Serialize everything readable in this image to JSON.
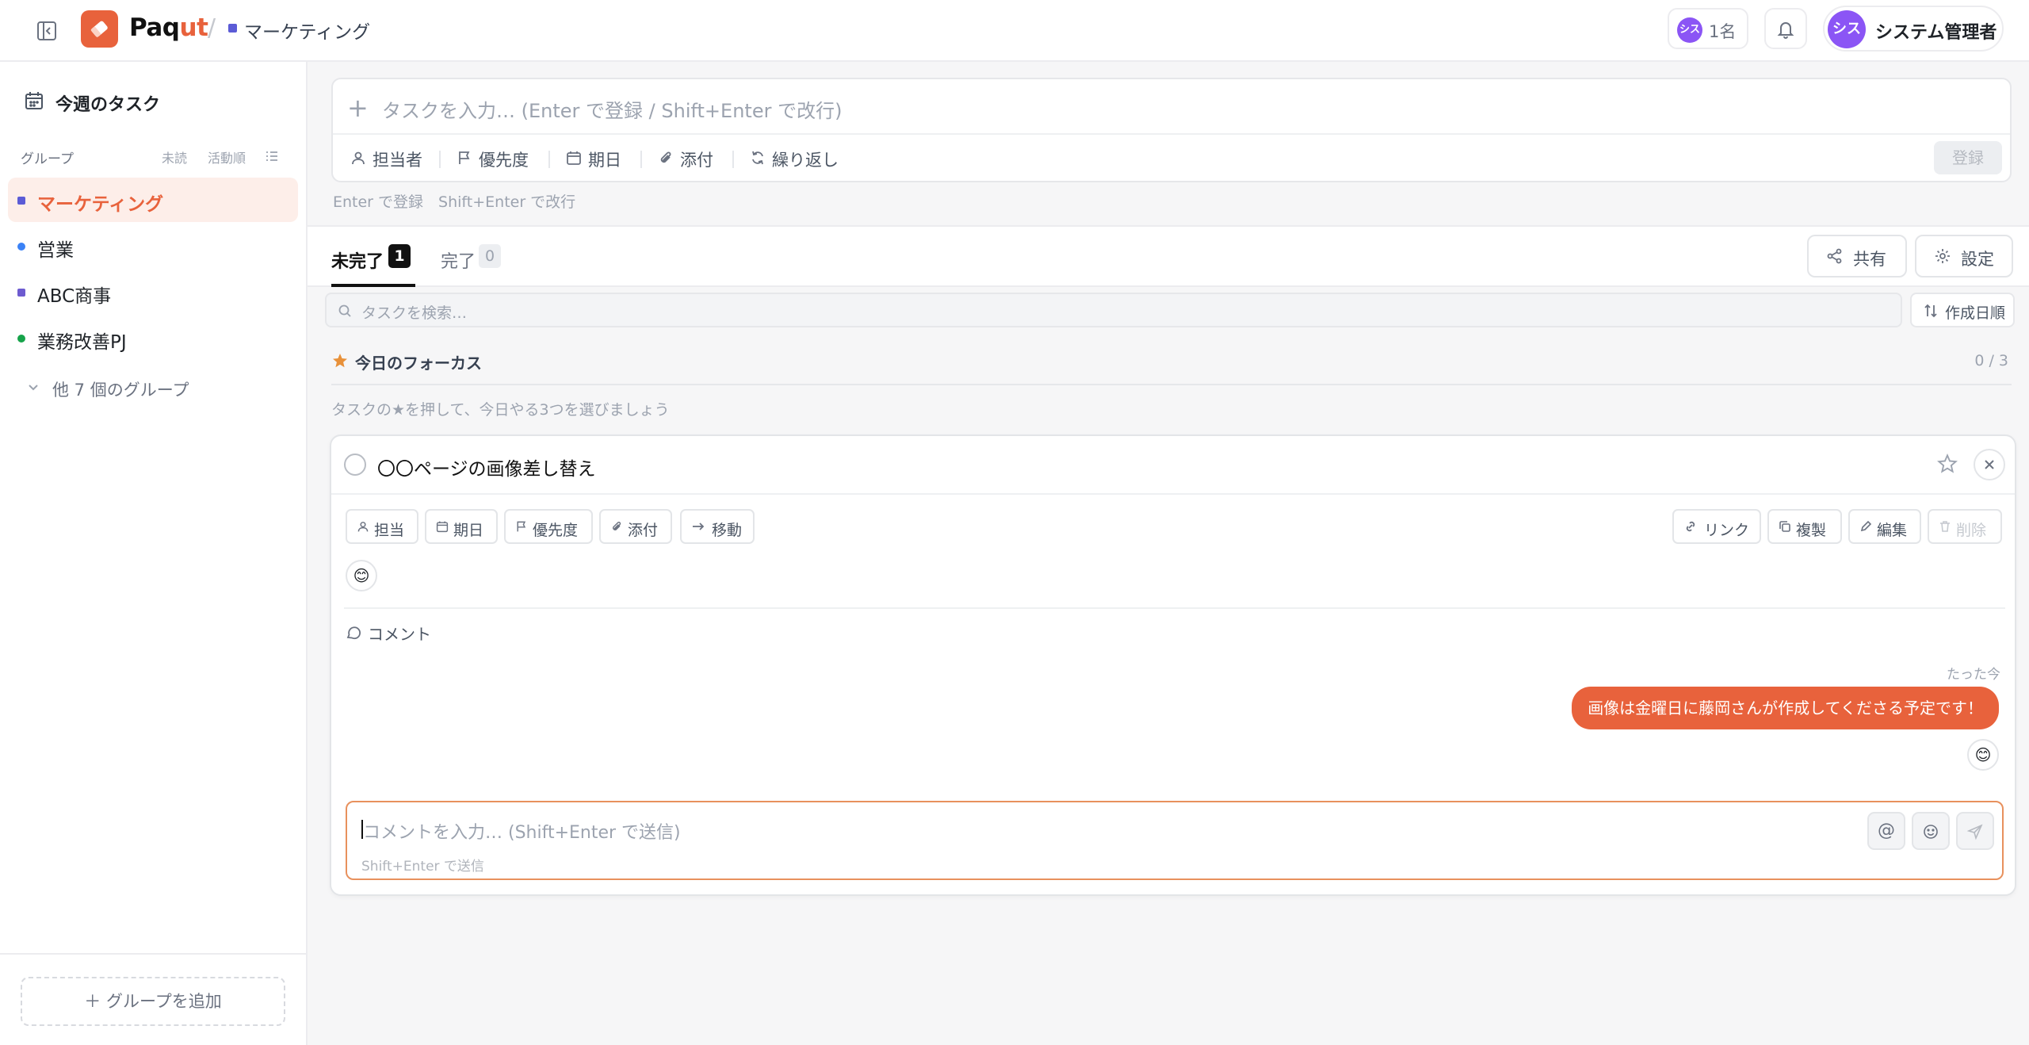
{
  "brand": {
    "name_main": "Paq",
    "name_accent": "ut",
    "accent_color": "#e8623c"
  },
  "header": {
    "breadcrumb_group": "マーケティング",
    "members_avatar": "シス",
    "members_count": "1名",
    "user_avatar": "シス",
    "user_name": "システム管理者",
    "icons": [
      "sidebar-toggle-icon",
      "bell-icon"
    ]
  },
  "sidebar": {
    "this_week": "今週のタスク",
    "group_header": {
      "label": "グループ",
      "sort_unread": "未読",
      "sort_activity": "活動順"
    },
    "groups": [
      {
        "label": "マーケティング",
        "color": "#5b5bd6",
        "active": true
      },
      {
        "label": "営業",
        "color": "#3b82f6"
      },
      {
        "label": "ABC商事",
        "color": "#6d5bd0"
      },
      {
        "label": "業務改善PJ",
        "color": "#16a34a"
      }
    ],
    "more_groups": "他 7 個のグループ",
    "add_group": "グループを追加"
  },
  "composer": {
    "placeholder": "タスクを入力… (Enter で登録 / Shift+Enter で改行)",
    "tools": [
      "担当者",
      "優先度",
      "期日",
      "添付",
      "繰り返し"
    ],
    "submit": "登録",
    "hint": "Enter で登録　Shift+Enter で改行"
  },
  "tabs": [
    {
      "label": "未完了",
      "count": "1",
      "active": true
    },
    {
      "label": "完了",
      "count": "0"
    }
  ],
  "actions": {
    "share": "共有",
    "settings": "設定"
  },
  "search": {
    "placeholder": "タスクを検索…",
    "sort_label": "作成日順"
  },
  "focus": {
    "title": "今日のフォーカス",
    "count": "0 / 3",
    "hint": "タスクの★を押して、今日やる3つを選びましょう"
  },
  "task": {
    "title": "〇〇ページの画像差し替え",
    "chips_left": [
      "担当",
      "期日",
      "優先度",
      "添付",
      "移動"
    ],
    "chips_right": [
      "リンク",
      "複製",
      "編集",
      "削除"
    ],
    "reaction_emoji": "😊",
    "comments_label": "コメント",
    "comment": {
      "time": "たった今",
      "text": "画像は金曜日に藤岡さんが作成してくださる予定です！",
      "reaction_emoji": "😊"
    },
    "comment_input": {
      "placeholder": "コメントを入力… (Shift+Enter で送信)",
      "sub_hint": "Shift+Enter で送信",
      "at_symbol": "@"
    }
  }
}
